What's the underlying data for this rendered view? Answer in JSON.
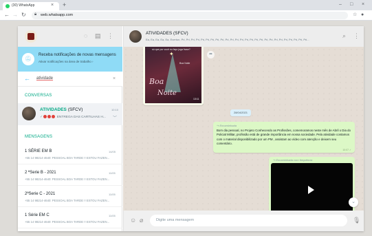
{
  "browser": {
    "tab_title": "(30) WhatsApp",
    "tab_close": "×",
    "new_tab": "+",
    "url": "web.whatsapp.com",
    "win_min": "–",
    "win_max": "□",
    "win_close": "×"
  },
  "sidebar": {
    "notification_title": "Receba notificações de novas mensagens",
    "notification_sub": "Ativar notificações na área de trabalho ›",
    "search_value": "atividade",
    "section_conversas": "CONVERSAS",
    "section_mensagens": "MENSAGENS",
    "chat_result": {
      "name_highlight": "ATIVIDADES",
      "name_rest": " (SFCV)",
      "time": "10:10",
      "preview": "ENTREGA DAS CARTILHAS H..."
    },
    "messages": [
      {
        "name": "1 SÉRIE EM B",
        "time": "14/05",
        "preview": "+55 14 98214-4640: PESSOAL BOA TARDE !! ESTOU FAZEN..."
      },
      {
        "name": "2 ªSerie B - 2021",
        "time": "11/05",
        "preview": "+55 14 98214-4640: PESSOAL BOA TARDE !! ESTOU FAZEN..."
      },
      {
        "name": "2ªSerie C - 2021",
        "time": "11/05",
        "preview": "+55 14 98214-4640: PESSOAL BOA TARDE !! ESTOU FAZEN..."
      },
      {
        "name": "1 Série EM C",
        "time": "11/05",
        "preview": "+55 14 98214-4640: PESSOAL BOA TARDE !! ESTOU FAZEN..."
      }
    ]
  },
  "conversation": {
    "title": "ATIVIDADES (SFCV)",
    "members": "Ea, Ea, Ea, Ea, Ea, Everton, Pri, Pri, Pri, Pri, Pri, Pri, Pri, Pri, Pri, Pri, Pri, Pri, Pri, Pri, Pri, Pri, Pri, Pri, Pri, Pri, Pri, Pri, Pri, Pri, Pri, Pri...",
    "image_caption_top": "só que por você eu faço joga frase?",
    "image_caption_right": "Boa Noite",
    "image_text_1": "Boa",
    "image_text_2": "Noite",
    "image_time": "13:11",
    "date_chip": "28/04/2021",
    "forwarded_label": "↪ Encaminhada",
    "text_body": "Bom dia pessoal, no Projeto Conhecendo as Profissões, comemoramos neste mês de Abril o Dia do Policial Militar, profissão está de grande importância em nossa sociedade. Pela atividade contamos com o material disponibilizado por um PM , assistam ao vídeo com atenção e deixem seu comentário.",
    "text_time": "10:07 ✓",
    "video_label": "↪ Encaminhada com frequência",
    "video_duration": "▶ 3:07",
    "video_time": "11:04 ✓"
  },
  "composer": {
    "placeholder": "Digite uma mensagem"
  }
}
